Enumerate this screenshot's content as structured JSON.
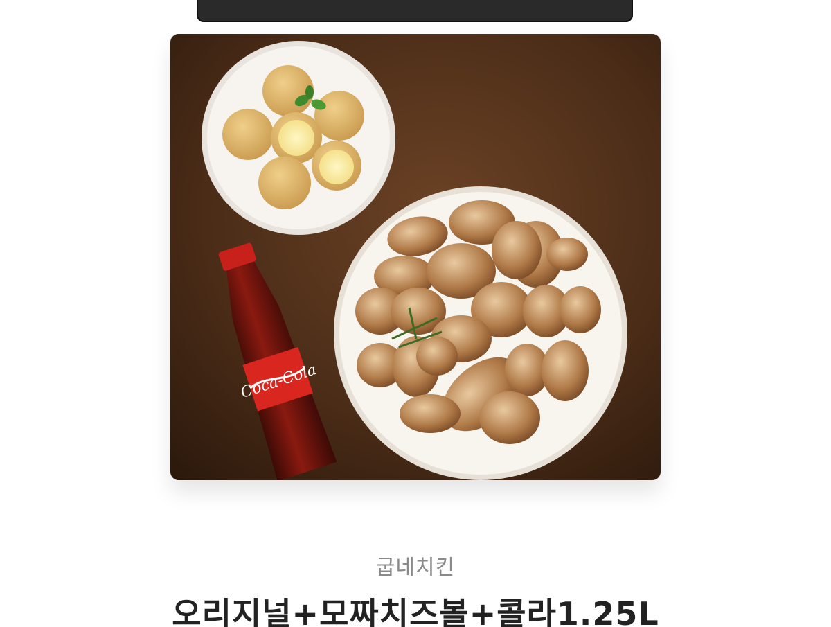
{
  "gift": {
    "brand": "굽네치킨",
    "product_name": "오리지널+모짜치즈볼+콜라1.25L",
    "image_label": "Coca-Cola"
  },
  "colors": {
    "background": "#ffffff",
    "brand_text": "#8a8a8a",
    "product_text": "#222222",
    "image_background": "#4a2c17"
  },
  "icons": {
    "product_photo": "photo of roasted chicken, cheese balls and cola bottle"
  }
}
